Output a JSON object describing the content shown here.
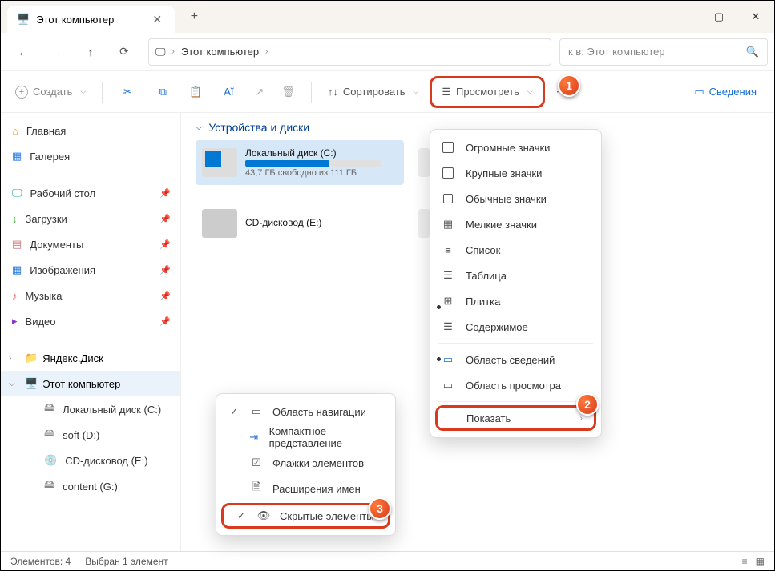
{
  "window": {
    "title": "Этот компьютер"
  },
  "nav": {
    "breadcrumb": "Этот компьютер"
  },
  "search": {
    "placeholder": "к в: Этот компьютер"
  },
  "toolbar": {
    "create": "Создать",
    "sort": "Сортировать",
    "view": "Просмотреть",
    "details": "Сведения"
  },
  "sidebar": {
    "home": "Главная",
    "gallery": "Галерея",
    "desktop": "Рабочий стол",
    "downloads": "Загрузки",
    "documents": "Документы",
    "pictures": "Изображения",
    "music": "Музыка",
    "videos": "Видео",
    "yandex": "Яндекс.Диск",
    "thispc": "Этот компьютер",
    "drive_c": "Локальный диск (C:)",
    "drive_d": "soft (D:)",
    "drive_e": "CD-дисковод (E:)",
    "drive_g": "content (G:)"
  },
  "content": {
    "group": "Устройства и диски",
    "c_name": "Локальный диск (C:)",
    "c_sub": "43,7 ГБ свободно из 111 ГБ",
    "c_fill_pct": 61,
    "e_name": "CD-дисковод (E:)"
  },
  "viewmenu": {
    "xl": "Огромные значки",
    "lg": "Крупные значки",
    "md": "Обычные значки",
    "sm": "Мелкие значки",
    "list": "Список",
    "table": "Таблица",
    "tiles": "Плитка",
    "content": "Содержимое",
    "detailpane": "Область сведений",
    "previewpane": "Область просмотра",
    "show": "Показать"
  },
  "showmenu": {
    "navpane": "Область навигации",
    "compact": "Компактное представление",
    "checkboxes": "Флажки элементов",
    "extensions": "Расширения имен",
    "hidden": "Скрытые элементы"
  },
  "status": {
    "count": "Элементов: 4",
    "selected": "Выбран 1 элемент"
  }
}
